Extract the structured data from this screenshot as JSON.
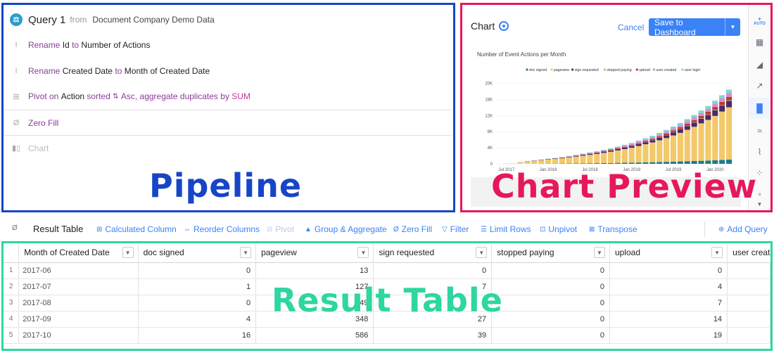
{
  "pipeline": {
    "query_title": "Query 1",
    "from_label": "from",
    "source": "Document Company Demo Data",
    "rename1": {
      "kw": "Rename",
      "old": "Id",
      "to": "to",
      "new": "Number of Actions"
    },
    "rename2": {
      "kw": "Rename",
      "old": "Created Date",
      "to": "to",
      "new": "Month of Created Date"
    },
    "pivot": {
      "kw": "Pivot on",
      "field": "Action",
      "sorted": "sorted",
      "order": "Asc, aggregate duplicates by",
      "agg": "SUM"
    },
    "zero_fill": "Zero Fill",
    "chart_step": "Chart",
    "overlay_label": "Pipeline"
  },
  "chart_panel": {
    "title": "Chart",
    "cancel": "Cancel",
    "save": "Save to Dashboard",
    "overlay_label": "Chart Preview",
    "auto_label": "AUTO"
  },
  "chart_data": {
    "type": "bar",
    "stacked": true,
    "title": "Number of Event Actions per Month",
    "legend_position": "top-right",
    "ylim": [
      0,
      22000
    ],
    "yticks": [
      "0",
      "4K",
      "8K",
      "12K",
      "16K",
      "20K"
    ],
    "xticks": [
      "Jul 2017",
      "Jan 2018",
      "Jul 2018",
      "Jan 2019",
      "Jul 2019",
      "Jan 2020"
    ],
    "categories": [
      "2017-06",
      "2017-07",
      "2017-08",
      "2017-09",
      "2017-10",
      "2017-11",
      "2017-12",
      "2018-01",
      "2018-02",
      "2018-03",
      "2018-04",
      "2018-05",
      "2018-06",
      "2018-07",
      "2018-08",
      "2018-09",
      "2018-10",
      "2018-11",
      "2018-12",
      "2019-01",
      "2019-02",
      "2019-03",
      "2019-04",
      "2019-05",
      "2019-06",
      "2019-07",
      "2019-08",
      "2019-09",
      "2019-10",
      "2019-11",
      "2019-12",
      "2020-01",
      "2020-02",
      "2020-03"
    ],
    "series": [
      {
        "name": "doc signed",
        "color": "#1f7a8c",
        "values": [
          0,
          1,
          0,
          4,
          16,
          25,
          35,
          45,
          55,
          70,
          80,
          100,
          120,
          140,
          160,
          180,
          200,
          230,
          260,
          300,
          330,
          370,
          410,
          450,
          500,
          550,
          600,
          650,
          700,
          760,
          820,
          900,
          980,
          1050
        ]
      },
      {
        "name": "pageview",
        "color": "#f2c96b",
        "values": [
          13,
          40,
          60,
          348,
          586,
          700,
          850,
          1000,
          1150,
          1300,
          1500,
          1700,
          1900,
          2100,
          2300,
          2550,
          2800,
          3100,
          3400,
          3700,
          4100,
          4500,
          4900,
          5400,
          5900,
          6500,
          7100,
          7800,
          8500,
          9300,
          10100,
          11000,
          12000,
          13000
        ]
      },
      {
        "name": "sign requested",
        "color": "#4b2a6b",
        "values": [
          0,
          7,
          7,
          27,
          39,
          50,
          60,
          75,
          90,
          105,
          125,
          150,
          175,
          200,
          230,
          260,
          290,
          330,
          370,
          410,
          460,
          510,
          570,
          630,
          700,
          780,
          860,
          950,
          1050,
          1150,
          1250,
          1400,
          1500,
          1600
        ]
      },
      {
        "name": "stopped paying",
        "color": "#9bd36f",
        "values": [
          0,
          0,
          0,
          0,
          0,
          2,
          3,
          4,
          5,
          6,
          8,
          10,
          12,
          14,
          16,
          18,
          20,
          24,
          28,
          32,
          36,
          40,
          45,
          50,
          55,
          60,
          66,
          72,
          80,
          88,
          96,
          105,
          115,
          125
        ]
      },
      {
        "name": "upload",
        "color": "#c0392b",
        "values": [
          0,
          4,
          7,
          14,
          19,
          25,
          32,
          40,
          48,
          56,
          66,
          78,
          90,
          104,
          118,
          134,
          150,
          170,
          190,
          215,
          240,
          270,
          300,
          335,
          370,
          410,
          450,
          495,
          545,
          600,
          660,
          720,
          790,
          860
        ]
      },
      {
        "name": "user created",
        "color": "#d98bd4",
        "values": [
          2,
          8,
          10,
          20,
          30,
          40,
          50,
          60,
          70,
          85,
          100,
          115,
          130,
          150,
          170,
          190,
          210,
          235,
          260,
          290,
          320,
          350,
          385,
          420,
          460,
          500,
          545,
          590,
          640,
          690,
          740,
          800,
          860,
          920
        ]
      },
      {
        "name": "user login",
        "color": "#7fd6cf",
        "values": [
          1,
          6,
          8,
          18,
          28,
          35,
          45,
          55,
          65,
          75,
          90,
          105,
          120,
          135,
          150,
          170,
          190,
          210,
          235,
          260,
          290,
          320,
          350,
          385,
          420,
          460,
          500,
          545,
          590,
          640,
          690,
          745,
          800,
          860
        ]
      }
    ]
  },
  "toolbar": {
    "title": "Result Table",
    "calculated_column": "Calculated Column",
    "reorder_columns": "Reorder Columns",
    "pivot": "Pivot",
    "group_aggregate": "Group & Aggregate",
    "zero_fill": "Zero Fill",
    "filter": "Filter",
    "limit_rows": "Limit Rows",
    "unpivot": "Unpivot",
    "transpose": "Transpose",
    "add_query": "Add Query"
  },
  "table": {
    "overlay_label": "Result Table",
    "headers": [
      "Month of Created Date",
      "doc signed",
      "pageview",
      "sign requested",
      "stopped paying",
      "upload",
      "user creat"
    ],
    "rows": [
      {
        "n": "1",
        "cells": [
          "2017-06",
          "0",
          "13",
          "0",
          "0",
          "0",
          ""
        ]
      },
      {
        "n": "2",
        "cells": [
          "2017-07",
          "1",
          "127",
          "7",
          "0",
          "4",
          ""
        ]
      },
      {
        "n": "3",
        "cells": [
          "2017-08",
          "0",
          "149",
          "7",
          "0",
          "7",
          ""
        ]
      },
      {
        "n": "4",
        "cells": [
          "2017-09",
          "4",
          "348",
          "27",
          "0",
          "14",
          ""
        ]
      },
      {
        "n": "5",
        "cells": [
          "2017-10",
          "16",
          "586",
          "39",
          "0",
          "19",
          ""
        ]
      }
    ]
  }
}
